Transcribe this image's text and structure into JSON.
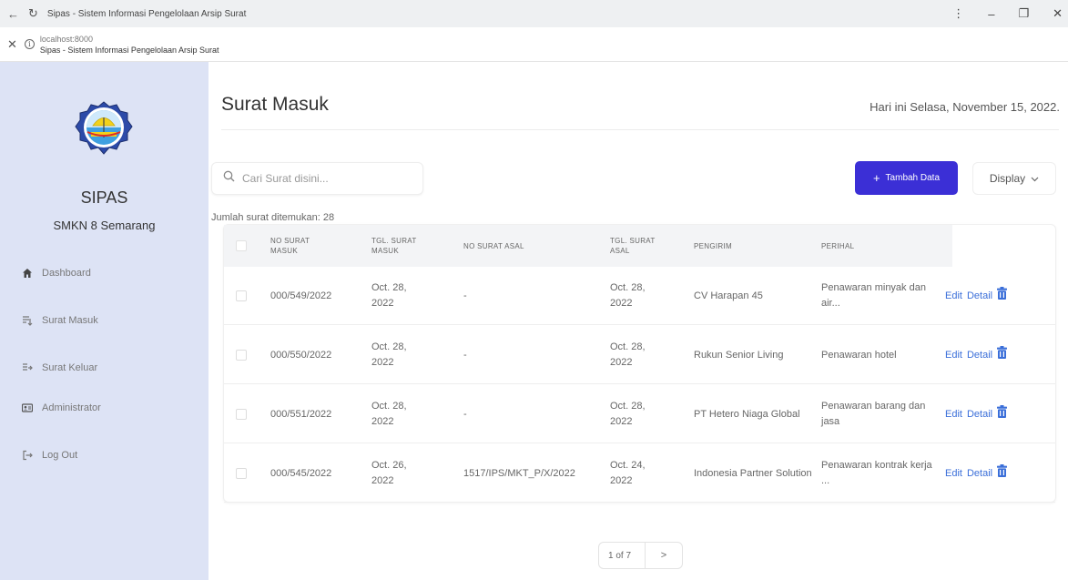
{
  "browser": {
    "window_title": "Sipas - Sistem Informasi Pengelolaan Arsip Surat",
    "url": "localhost:8000",
    "page_title": "Sipas - Sistem Informasi Pengelolaan Arsip Surat"
  },
  "sidebar": {
    "app_name": "SIPAS",
    "school": "SMKN 8 Semarang",
    "items": [
      {
        "label": "Dashboard",
        "icon": "home-icon"
      },
      {
        "label": "Surat Masuk",
        "icon": "inbox-icon"
      },
      {
        "label": "Surat Keluar",
        "icon": "outbox-icon"
      },
      {
        "label": "Administrator",
        "icon": "admin-icon"
      },
      {
        "label": "Log Out",
        "icon": "logout-icon"
      }
    ]
  },
  "main": {
    "title": "Surat Masuk",
    "date_text": "Hari ini Selasa, November 15, 2022.",
    "search_placeholder": "Cari Surat disini...",
    "add_button": "Tambah Data",
    "add_button_color": "#3b2fd6",
    "display_button": "Display",
    "count_text": "Jumlah surat ditemukan: 28"
  },
  "table": {
    "headers": [
      "NO SURAT MASUK",
      "TGL. SURAT MASUK",
      "NO SURAT ASAL",
      "TGL. SURAT ASAL",
      "PENGIRIM",
      "PERIHAL"
    ],
    "rows": [
      {
        "no_surat_masuk": "000/549/2022",
        "tgl_surat_masuk": "Oct. 28, 2022",
        "no_surat_asal": "-",
        "tgl_surat_asal": "Oct. 28, 2022",
        "pengirim": "CV Harapan 45",
        "perihal": "Penawaran minyak dan air..."
      },
      {
        "no_surat_masuk": "000/550/2022",
        "tgl_surat_masuk": "Oct. 28, 2022",
        "no_surat_asal": "-",
        "tgl_surat_asal": "Oct. 28, 2022",
        "pengirim": "Rukun Senior Living",
        "perihal": "Penawaran hotel"
      },
      {
        "no_surat_masuk": "000/551/2022",
        "tgl_surat_masuk": "Oct. 28, 2022",
        "no_surat_asal": "-",
        "tgl_surat_asal": "Oct. 28, 2022",
        "pengirim": "PT Hetero Niaga Global",
        "perihal": "Penawaran barang dan jasa"
      },
      {
        "no_surat_masuk": "000/545/2022",
        "tgl_surat_masuk": "Oct. 26, 2022",
        "no_surat_asal": "1517/IPS/MKT_P/X/2022",
        "tgl_surat_asal": "Oct. 24, 2022",
        "pengirim": "Indonesia Partner Solution",
        "perihal": "Penawaran kontrak kerja ..."
      }
    ],
    "edit_label": "Edit",
    "detail_label": "Detail",
    "link_color": "#3b6fd9"
  },
  "pagination": {
    "page_text": "1 of 7",
    "next_label": ">"
  }
}
